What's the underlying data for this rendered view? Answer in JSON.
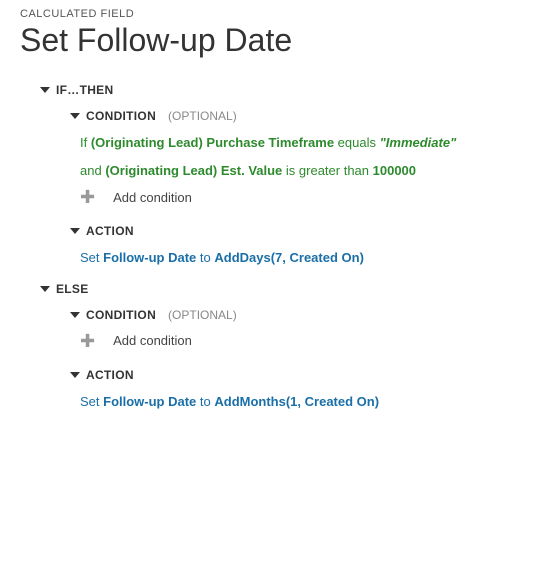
{
  "header": {
    "overline": "CALCULATED FIELD",
    "title": "Set Follow-up Date"
  },
  "labels": {
    "if_then": "IF…THEN",
    "else": "ELSE",
    "condition": "CONDITION",
    "optional": "(OPTIONAL)",
    "action": "ACTION",
    "add_condition": "Add condition"
  },
  "if_branch": {
    "cond1": {
      "prefix": "If ",
      "field": "(Originating Lead) Purchase Timeframe",
      "operator": " equals ",
      "value": "\"Immediate\""
    },
    "cond2": {
      "prefix": "and ",
      "field": "(Originating Lead) Est. Value",
      "operator": " is greater than ",
      "value": "100000"
    },
    "action": {
      "set": "Set ",
      "target": "Follow-up Date",
      "to": " to ",
      "func": "AddDays(7, Created On)"
    }
  },
  "else_branch": {
    "action": {
      "set": "Set ",
      "target": "Follow-up Date",
      "to": " to ",
      "func": "AddMonths(1, Created On)"
    }
  }
}
